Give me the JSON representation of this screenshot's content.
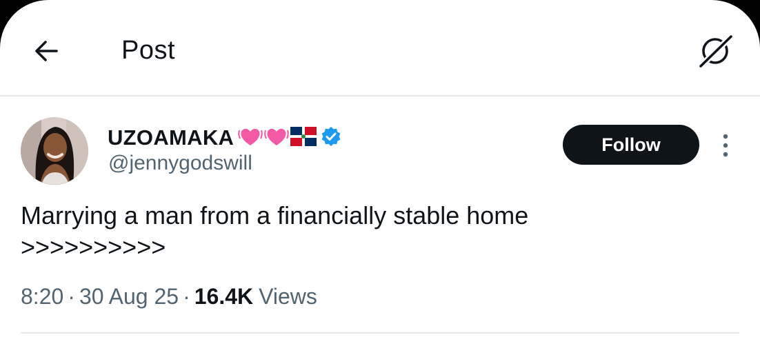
{
  "header": {
    "title": "Post",
    "back_icon": "arrow-left-icon",
    "grok_icon": "grok-icon"
  },
  "author": {
    "display_name": "UZOAMAKA",
    "handle": "@jennygodswill",
    "name_emojis": [
      "growing-heart",
      "growing-heart",
      "dominican-republic-flag"
    ],
    "verified": true,
    "verified_color": "#1d9bf0"
  },
  "follow_button": {
    "label": "Follow"
  },
  "post": {
    "text_line_1": "Marrying a man from a financially stable home",
    "text_line_2": ">>>>>>>>>>"
  },
  "meta": {
    "time": "8:20",
    "separator": "·",
    "date": "30 Aug 25",
    "views_count": "16.4K",
    "views_label": "Views"
  },
  "colors": {
    "text_primary": "#0f1419",
    "text_secondary": "#536471",
    "follow_bg": "#0f1419",
    "divider": "#e6e8ea",
    "heart": "#f25aa5"
  }
}
